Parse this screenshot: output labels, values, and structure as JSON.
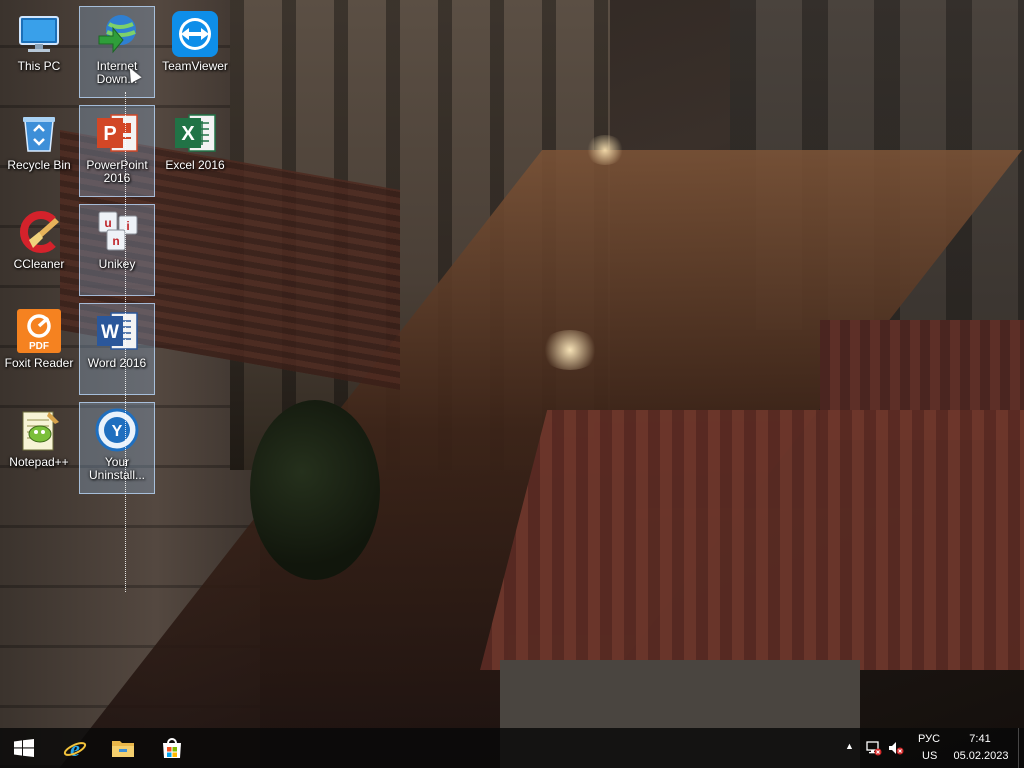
{
  "desktop": {
    "icons": [
      {
        "id": "this-pc",
        "label": "This PC",
        "selected": false
      },
      {
        "id": "internet-download-manager",
        "label": "Internet Down...",
        "selected": true
      },
      {
        "id": "teamviewer",
        "label": "TeamViewer",
        "selected": false
      },
      {
        "id": "recycle-bin",
        "label": "Recycle Bin",
        "selected": false
      },
      {
        "id": "powerpoint-2016",
        "label": "PowerPoint 2016",
        "selected": true
      },
      {
        "id": "excel-2016",
        "label": "Excel 2016",
        "selected": false
      },
      {
        "id": "ccleaner",
        "label": "CCleaner",
        "selected": false
      },
      {
        "id": "unikey",
        "label": "Unikey",
        "selected": true
      },
      {
        "id": "foxit-reader",
        "label": "Foxit Reader",
        "selected": false
      },
      {
        "id": "word-2016",
        "label": "Word 2016",
        "selected": true
      },
      {
        "id": "notepad-plus-plus",
        "label": "Notepad++",
        "selected": false
      },
      {
        "id": "your-uninstaller",
        "label": "Your Uninstall...",
        "selected": true
      }
    ]
  },
  "taskbar": {
    "pinned": [
      {
        "label": "Start",
        "icon": "windows-logo-icon"
      },
      {
        "label": "Internet Explorer",
        "icon": "internet-explorer-icon"
      },
      {
        "label": "File Explorer",
        "icon": "folder-icon"
      },
      {
        "label": "Store",
        "icon": "store-icon"
      }
    ],
    "tray": {
      "language": "РУС",
      "layout": "US",
      "time": "7:41",
      "date": "05.02.2023",
      "chevron": "▲"
    }
  },
  "colors": {
    "taskbar_bg": "#080808",
    "selection": "#96bee6"
  }
}
